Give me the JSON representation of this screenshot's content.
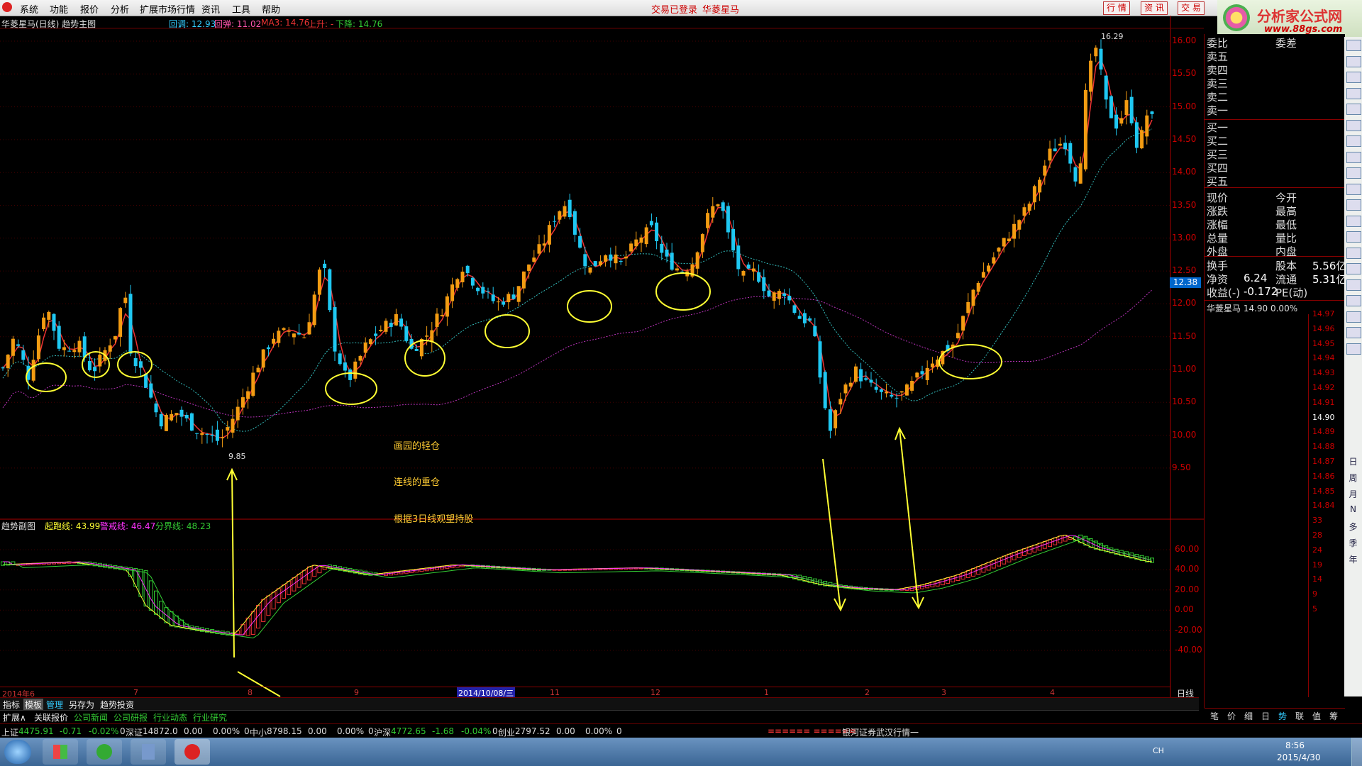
{
  "menu": [
    "系统",
    "功能",
    "报价",
    "分析",
    "扩展市场行情",
    "资讯",
    "工具",
    "帮助"
  ],
  "login_status": "交易已登录",
  "stock_name_top": "华菱星马",
  "top_buttons": [
    "行 情",
    "资 讯",
    "交 易"
  ],
  "logo": {
    "text": "分析家公式网",
    "url": "www.88gs.com"
  },
  "main_chart": {
    "title": "华菱星马(日线) 趋势主图",
    "legend": [
      {
        "label": "回调: 12.93",
        "color": "#3cf"
      },
      {
        "label": "回弹: 11.02",
        "color": "#f5a"
      },
      {
        "label": "MA3: 14.76",
        "color": "#e33"
      },
      {
        "label": "上升: -",
        "color": "#e33"
      },
      {
        "label": "下降: 14.76",
        "color": "#3c3"
      }
    ],
    "price_ticks": [
      "16.00",
      "15.50",
      "15.00",
      "14.50",
      "14.00",
      "13.50",
      "13.00",
      "12.50",
      "12.00",
      "11.50",
      "11.00",
      "10.50",
      "10.00",
      "9.50"
    ],
    "current_price_tag": "12.38",
    "high_label": "16.29",
    "low_label": "9.85",
    "annotations": [
      "画园的轻仓",
      "连线的重仓",
      "根据3日线观望持股"
    ]
  },
  "sub_chart": {
    "title": "趋势副图",
    "legend": [
      {
        "label": "起跑线: 43.99",
        "color": "#ff3"
      },
      {
        "label": "警戒线: 46.47",
        "color": "#f3f"
      },
      {
        "label": "分界线: 48.23",
        "color": "#3c3"
      }
    ],
    "ticks": [
      "60.00",
      "40.00",
      "20.00",
      "0.00",
      "-20.00",
      "-40.00"
    ]
  },
  "date_axis": {
    "labels": [
      "2014年6",
      "7",
      "8",
      "9",
      "2014/10/08/三",
      "11",
      "12",
      "1",
      "2",
      "3",
      "4"
    ],
    "period": "日线"
  },
  "bottom_tabs": [
    "指标",
    "模板",
    "管理",
    "另存为",
    "趋势投资"
  ],
  "bottom_tabs2": [
    "扩展∧",
    "关联报价",
    "公司新闻",
    "公司研报",
    "行业动态",
    "行业研究"
  ],
  "order_book": {
    "header": [
      "委比",
      "委差"
    ],
    "sells": [
      "卖五",
      "卖四",
      "卖三",
      "卖二",
      "卖一"
    ],
    "buys": [
      "买一",
      "买二",
      "买三",
      "买四",
      "买五"
    ],
    "stats": [
      [
        "现价",
        "今开"
      ],
      [
        "涨跌",
        "最高"
      ],
      [
        "涨幅",
        "最低"
      ],
      [
        "总量",
        "量比"
      ],
      [
        "外盘",
        "内盘"
      ]
    ],
    "fund": [
      {
        "l1": "换手",
        "v1": "",
        "l2": "股本",
        "v2": "5.56亿"
      },
      {
        "l1": "净资",
        "v1": "6.24",
        "l2": "流通",
        "v2": "5.31亿"
      },
      {
        "l1": "收益(-)",
        "v1": "-0.172",
        "l2": "PE(动)",
        "v2": ""
      }
    ],
    "mini_title": "华菱星马  14.90  0.00%",
    "mini_ticks": [
      "14.97",
      "14.96",
      "14.95",
      "14.94",
      "14.93",
      "14.92",
      "14.91",
      "14.90",
      "14.89",
      "14.88",
      "14.87",
      "14.86",
      "14.85",
      "14.84",
      "33",
      "28",
      "24",
      "19",
      "14",
      "9",
      "5"
    ],
    "tabs": [
      "笔",
      "价",
      "细",
      "日",
      "势",
      "联",
      "值",
      "筹"
    ]
  },
  "side_tools": [
    "日",
    "周",
    "月",
    "N",
    "多",
    "季",
    "年"
  ],
  "index_bar": [
    {
      "name": "上证",
      "val": "4475.91",
      "chg": "-0.71",
      "pct": "-0.02%",
      "vol": "0"
    },
    {
      "name": "深证",
      "val": "14872.0",
      "chg": "0.00",
      "pct": "0.00%",
      "vol": "0"
    },
    {
      "name": "中小",
      "val": "8798.15",
      "chg": "0.00",
      "pct": "0.00%",
      "vol": "0"
    },
    {
      "name": "沪深",
      "val": "4772.65",
      "chg": "-1.68",
      "pct": "-0.04%",
      "vol": "0"
    },
    {
      "name": "创业",
      "val": "2797.52",
      "chg": "0.00",
      "pct": "0.00%",
      "vol": "0"
    }
  ],
  "ticker": "银河证券武汉行情一",
  "ticker_mark": "====== ======",
  "taskbar": {
    "lang": "CH",
    "time": "8:56",
    "date": "2015/4/30"
  }
}
